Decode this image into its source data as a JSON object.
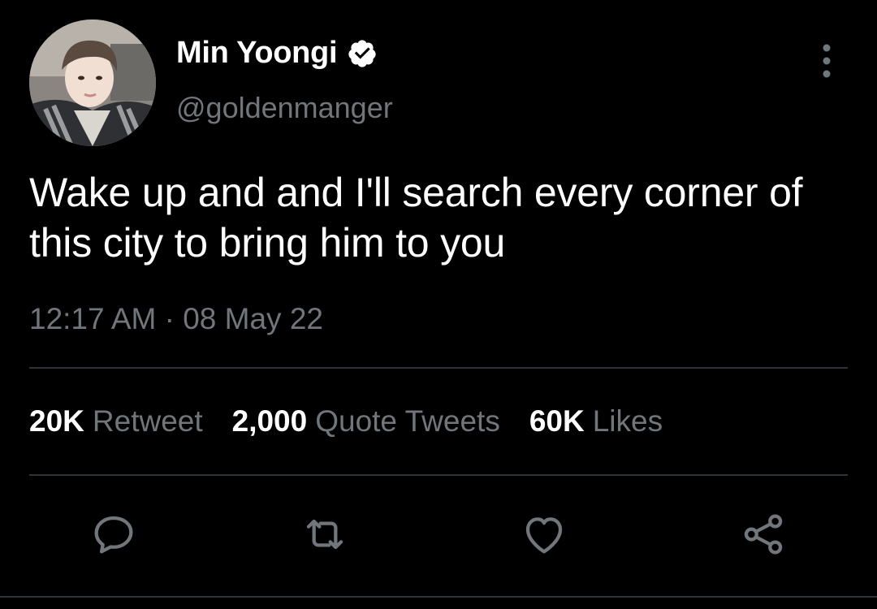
{
  "author": {
    "display_name": "Min Yoongi",
    "handle": "@goldenmanger",
    "verified": true
  },
  "tweet": {
    "text": "Wake up and and I'll search every corner of this city to bring him to you",
    "timestamp": "12:17 AM · 08 May 22"
  },
  "stats": {
    "retweets": {
      "count": "20K",
      "label": "Retweet"
    },
    "quotes": {
      "count": "2,000",
      "label": "Quote Tweets"
    },
    "likes": {
      "count": "60K",
      "label": "Likes"
    }
  },
  "icons": {
    "verified": "verified-badge-icon",
    "more": "more-vertical-icon",
    "reply": "reply-icon",
    "retweet": "retweet-icon",
    "like": "heart-icon",
    "share": "share-icon"
  },
  "colors": {
    "background": "#000000",
    "primary_text": "#ffffff",
    "secondary_text": "#71767b",
    "divider": "#2f3336",
    "icon": "#71767b"
  }
}
